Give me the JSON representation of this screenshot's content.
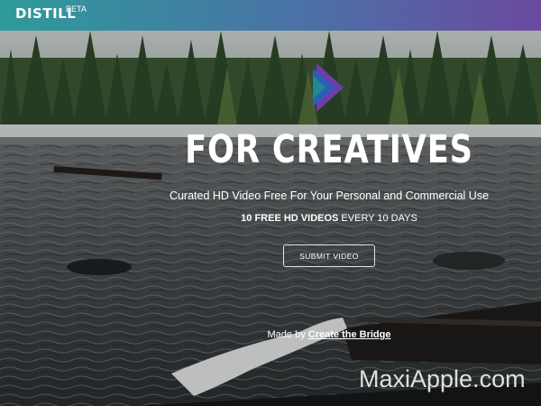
{
  "header": {
    "brand": "DISTILL",
    "badge": "BETA",
    "gradient_start": "#2e9b9a",
    "gradient_end": "#6a4a9f"
  },
  "hero": {
    "headline": "FOR CREATIVES",
    "subtitle": "Curated HD Video Free For Your Personal and Commercial Use",
    "count_bold": "10 FREE HD VIDEOS",
    "count_rest": " EVERY 10 DAYS",
    "submit_label": "SUBMIT VIDEO",
    "made_by_prefix": "Made by ",
    "made_by_link": "Create the Bridge"
  },
  "watermark": "MaxiApple.com",
  "colors": {
    "logo_blue": "#2a5fb8",
    "logo_purple": "#6a3fa8",
    "logo_teal": "#1f8a8f"
  }
}
